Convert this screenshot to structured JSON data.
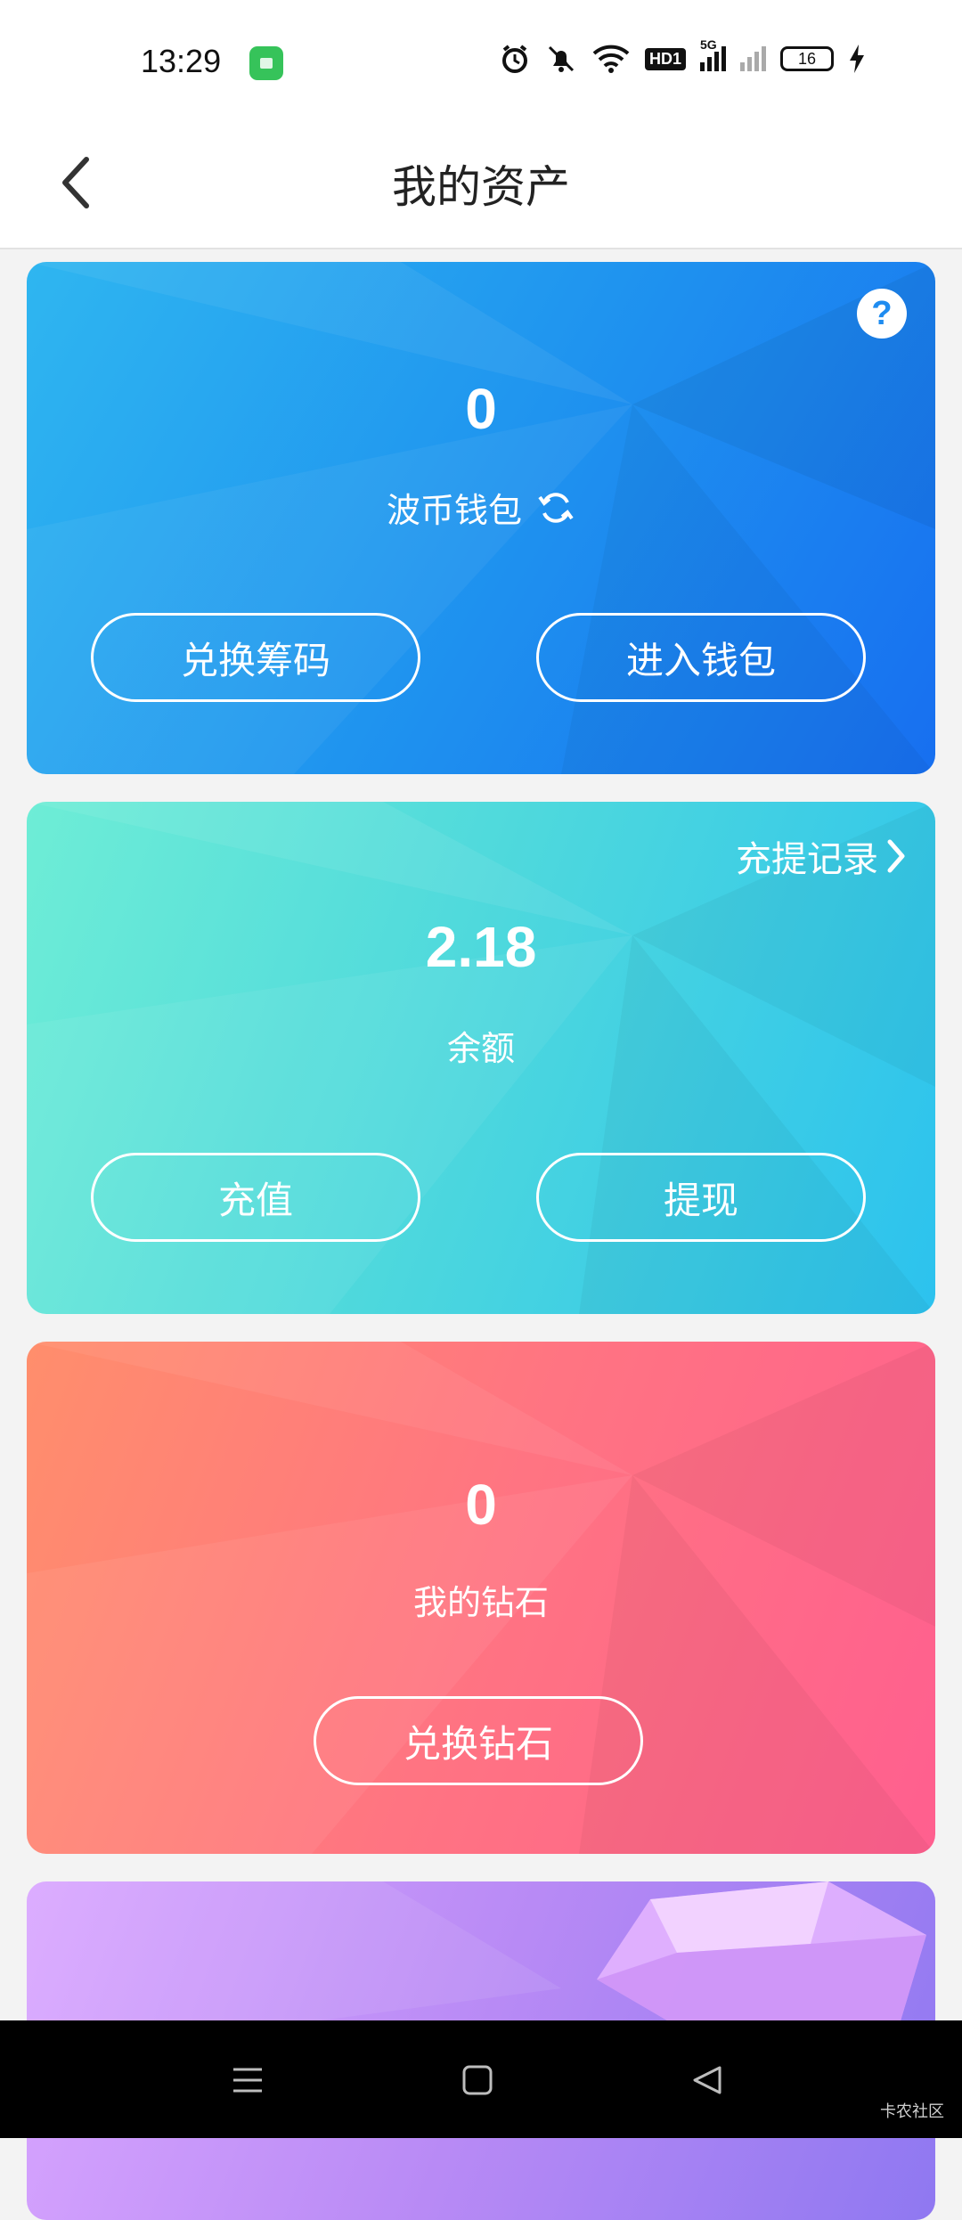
{
  "status_bar": {
    "time": "13:29",
    "battery_level": "16",
    "network_label": "5G",
    "hd_label": "HD1"
  },
  "header": {
    "title": "我的资产",
    "back_icon": "chevron-left-icon"
  },
  "wallet_card": {
    "amount": "0",
    "label": "波币钱包",
    "refresh_icon": "refresh-icon",
    "help_icon": "question-icon",
    "help_text": "?",
    "button_exchange": "兑换筹码",
    "button_enter": "进入钱包",
    "color_start": "#2fb6f0",
    "color_end": "#176ff0"
  },
  "balance_card": {
    "records_label": "充提记录",
    "amount": "2.18",
    "label": "余额",
    "button_recharge": "充值",
    "button_withdraw": "提现",
    "color_start": "#6eedd6",
    "color_end": "#2cc2ee"
  },
  "diamond_card": {
    "amount": "0",
    "label": "我的钻石",
    "button_exchange": "兑换钻石",
    "color_start": "#ff8e6c",
    "color_end": "#ff5f8f"
  },
  "nav_bar": {
    "menu_icon": "menu-icon",
    "home_icon": "square-home-icon",
    "back_icon": "triangle-back-icon"
  },
  "watermark": "卡农社区"
}
